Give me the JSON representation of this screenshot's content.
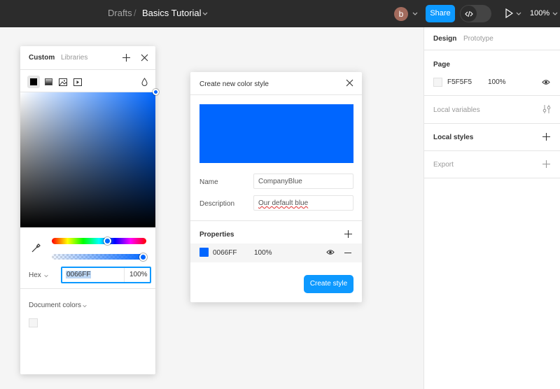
{
  "topbar": {
    "breadcrumb_folder": "Drafts",
    "breadcrumb_separator": "/",
    "file_name": "Basics Tutorial",
    "avatar_initial": "b",
    "share_label": "Share",
    "zoom": "100%"
  },
  "right_panel": {
    "tabs": [
      {
        "label": "Design",
        "active": true
      },
      {
        "label": "Prototype",
        "active": false
      }
    ],
    "page": {
      "title": "Page",
      "color_hex": "F5F5F5",
      "opacity": "100%"
    },
    "local_variables": "Local variables",
    "local_styles": "Local styles",
    "export": "Export"
  },
  "color_picker": {
    "tabs": [
      {
        "label": "Custom",
        "active": true
      },
      {
        "label": "Libraries",
        "active": false
      }
    ],
    "hex_mode_label": "Hex",
    "hex_value": "0066FF",
    "opacity": "100%",
    "document_colors_label": "Document colors"
  },
  "dialog": {
    "title": "Create new color style",
    "preview_color": "#0066FF",
    "name_label": "Name",
    "name_value": "CompanyBlue",
    "description_label": "Description",
    "description_value": "Our default blue",
    "properties_label": "Properties",
    "property": {
      "hex": "0066FF",
      "opacity": "100%"
    },
    "create_button": "Create style"
  },
  "colors": {
    "accent": "#0d99ff",
    "selected_color": "#0066ff",
    "toolbar_bg": "#2c2c2c",
    "canvas_bg": "#f5f5f5"
  }
}
